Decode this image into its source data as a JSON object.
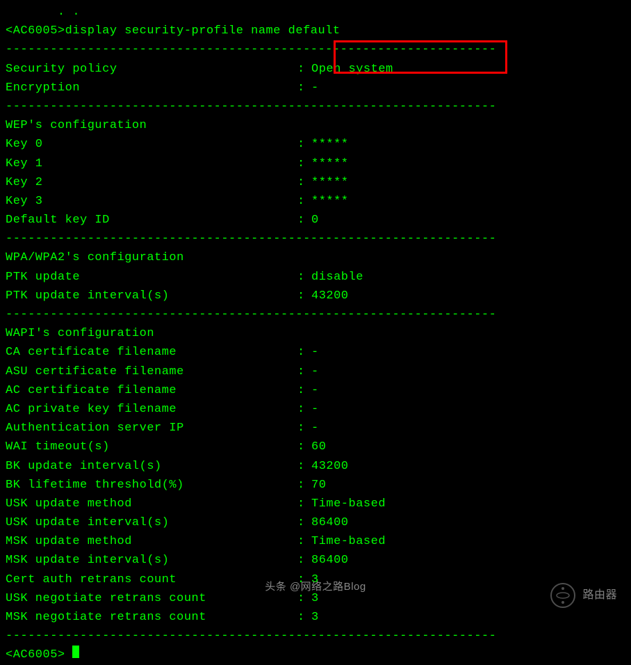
{
  "top_partial": "       . .",
  "command": "<AC6005>display security-profile name default",
  "divider": "------------------------------------------------------------------",
  "security": {
    "policy": {
      "label": "Security policy",
      "value": "Open system"
    },
    "encryption": {
      "label": "Encryption",
      "value": "-"
    }
  },
  "wep": {
    "header": "WEP's configuration",
    "key0": {
      "label": "Key 0",
      "value": "*****"
    },
    "key1": {
      "label": "Key 1",
      "value": "*****"
    },
    "key2": {
      "label": "Key 2",
      "value": "*****"
    },
    "key3": {
      "label": "Key 3",
      "value": "*****"
    },
    "default_key": {
      "label": "Default key ID",
      "value": "0"
    }
  },
  "wpa": {
    "header": "WPA/WPA2's configuration",
    "ptk_update": {
      "label": "PTK update",
      "value": "disable"
    },
    "ptk_interval": {
      "label": "PTK update interval(s)",
      "value": "43200"
    }
  },
  "wapi": {
    "header": "WAPI's configuration",
    "ca_cert": {
      "label": "CA certificate filename",
      "value": "-"
    },
    "asu_cert": {
      "label": "ASU certificate filename",
      "value": "-"
    },
    "ac_cert": {
      "label": "AC certificate filename",
      "value": "-"
    },
    "ac_key": {
      "label": "AC private key filename",
      "value": "-"
    },
    "auth_server": {
      "label": "Authentication server IP",
      "value": "-"
    },
    "wai_timeout": {
      "label": "WAI timeout(s)",
      "value": "60"
    },
    "bk_interval": {
      "label": "BK update interval(s)",
      "value": "43200"
    },
    "bk_lifetime": {
      "label": "BK lifetime threshold(%)",
      "value": "70"
    },
    "usk_method": {
      "label": "USK update method",
      "value": "Time-based"
    },
    "usk_interval": {
      "label": "USK update interval(s)",
      "value": "86400"
    },
    "msk_method": {
      "label": "MSK update method",
      "value": "Time-based"
    },
    "msk_interval": {
      "label": "MSK update interval(s)",
      "value": "86400"
    },
    "cert_retrans": {
      "label": "Cert auth retrans count",
      "value": "3"
    },
    "usk_retrans": {
      "label": "USK negotiate retrans count",
      "value": "3"
    },
    "msk_retrans": {
      "label": "MSK negotiate retrans count",
      "value": "3"
    }
  },
  "prompt": "<AC6005> ",
  "footer": "头条 @网络之路Blog",
  "watermark": "路由器"
}
